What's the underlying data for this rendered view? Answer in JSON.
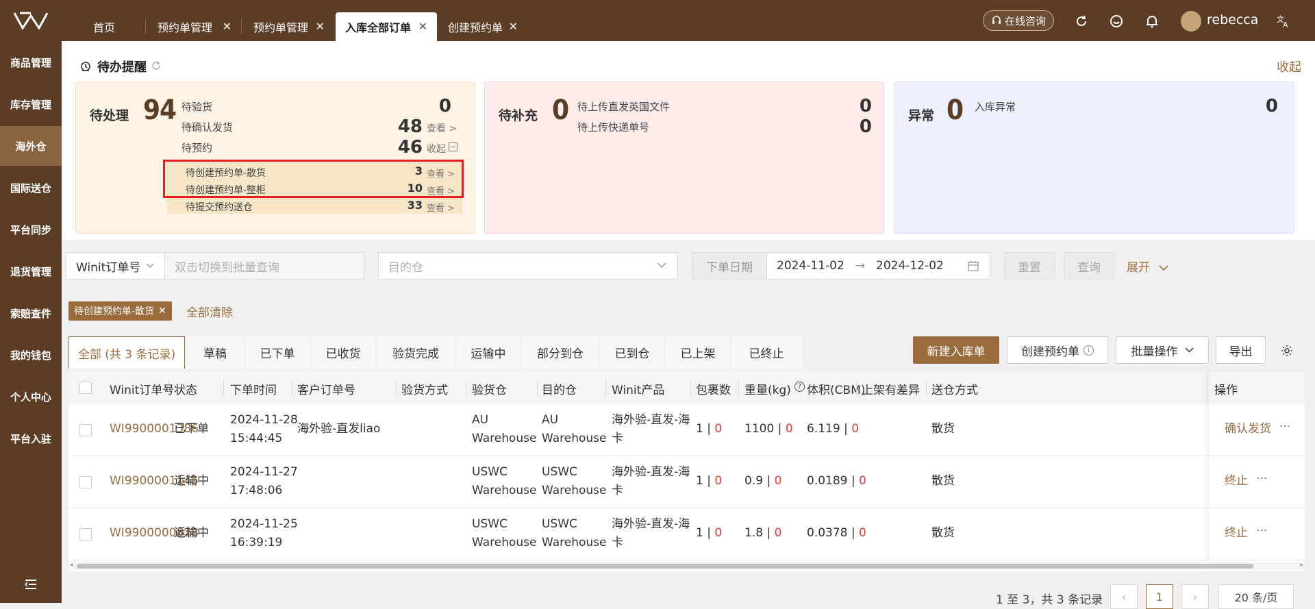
{
  "topbar": {
    "tabs": [
      {
        "label": "首页",
        "closable": false
      },
      {
        "label": "预约单管理",
        "closable": true
      },
      {
        "label": "预约单管理",
        "closable": true
      },
      {
        "label": "入库全部订单",
        "closable": true,
        "active": true
      },
      {
        "label": "创建预约单",
        "closable": true
      }
    ],
    "consult_label": "在线咨询",
    "username": "rebecca",
    "icons": [
      "refresh-icon",
      "smile-icon",
      "bell-icon",
      "translate-icon"
    ]
  },
  "sidebar": {
    "items": [
      "商品管理",
      "库存管理",
      "海外仓",
      "国际送仓",
      "平台同步",
      "退货管理",
      "索赔查件",
      "我的钱包",
      "个人中心",
      "平台入驻"
    ],
    "active_index": 2
  },
  "todo": {
    "title": "待办提醒",
    "collapse_label": "收起",
    "cards": [
      {
        "label": "待处理",
        "count": "94",
        "rows": [
          {
            "label": "待验货",
            "value": "0",
            "link": ""
          },
          {
            "label": "待确认发货",
            "value": "48",
            "link": "查看 >"
          },
          {
            "label": "待预约",
            "value": "46",
            "link": "收起"
          },
          {
            "label": "待创建预约单-散货",
            "value": "3",
            "link": "查看 >"
          },
          {
            "label": "待创建预约单-整柜",
            "value": "10",
            "link": "查看 >"
          },
          {
            "label": "待提交预约送仓",
            "value": "33",
            "link": "查看 >"
          }
        ]
      },
      {
        "label": "待补充",
        "count": "0",
        "rows": [
          {
            "label": "待上传直发英国文件",
            "value": "0"
          },
          {
            "label": "待上传快递单号",
            "value": "0"
          }
        ]
      },
      {
        "label": "异常",
        "count": "0",
        "rows": [
          {
            "label": "入库异常",
            "value": "0"
          }
        ]
      }
    ]
  },
  "filters": {
    "order_type": "Winit订单号",
    "batch_placeholder": "双击切换到批量查询",
    "warehouse_placeholder": "目的仓",
    "date_label": "下单日期",
    "date_start": "2024-11-02",
    "date_end": "2024-12-02",
    "reset_label": "重置",
    "query_label": "查询",
    "expand_label": "展开"
  },
  "chips": {
    "active_chip": "待创建预约单-散货",
    "clear_all": "全部清除"
  },
  "status_tabs": [
    "全部 (共 3 条记录)",
    "草稿",
    "已下单",
    "已收货",
    "验货完成",
    "运输中",
    "部分到仓",
    "已到仓",
    "已上架",
    "已终止"
  ],
  "actions": {
    "new_inbound": "新建入库单",
    "create_booking": "创建预约单",
    "batch_ops": "批量操作",
    "export": "导出"
  },
  "table": {
    "headers": [
      "Winit订单号",
      "状态",
      "下单时间",
      "客户订单号",
      "验货方式",
      "验货仓",
      "目的仓",
      "Winit产品",
      "包裹数",
      "重量(kg)",
      "体积(CBM)",
      "上架有差异",
      "送仓方式",
      "操作"
    ],
    "rows": [
      {
        "order": "WI9900001386",
        "status": "已下单",
        "date": "2024-11-28",
        "time": "15:44:45",
        "customer_order": "海外验-直发liao",
        "inspect_method": "",
        "inspect_wh": [
          "AU",
          "Warehouse"
        ],
        "dest_wh": [
          "AU",
          "Warehouse"
        ],
        "product": [
          "海外验-直发-海",
          "卡"
        ],
        "pkg": "1",
        "pkg_red": "0",
        "weight": "1100",
        "weight_red": "0",
        "volume": "6.119",
        "volume_red": "0",
        "diff": "",
        "delivery": "散货",
        "op": "确认发货"
      },
      {
        "order": "WI9900001145",
        "status": "运输中",
        "date": "2024-11-27",
        "time": "17:48:06",
        "customer_order": "",
        "inspect_method": "",
        "inspect_wh": [
          "USWC",
          "Warehouse"
        ],
        "dest_wh": [
          "USWC",
          "Warehouse"
        ],
        "product": [
          "海外验-直发-海",
          "卡"
        ],
        "pkg": "1",
        "pkg_red": "0",
        "weight": "0.9",
        "weight_red": "0",
        "volume": "0.0189",
        "volume_red": "0",
        "diff": "",
        "delivery": "散货",
        "op": "终止"
      },
      {
        "order": "WI9900000828",
        "status": "运输中",
        "date": "2024-11-25",
        "time": "16:39:19",
        "customer_order": "",
        "inspect_method": "",
        "inspect_wh": [
          "USWC",
          "Warehouse"
        ],
        "dest_wh": [
          "USWC",
          "Warehouse"
        ],
        "product": [
          "海外验-直发-海",
          "卡"
        ],
        "pkg": "1",
        "pkg_red": "0",
        "weight": "1.8",
        "weight_red": "0",
        "volume": "0.0378",
        "volume_red": "0",
        "diff": "",
        "delivery": "散货",
        "op": "终止"
      }
    ]
  },
  "pager": {
    "summary": "1 至 3，共 3 条记录",
    "current_page": "1",
    "page_size": "20 条/页"
  },
  "colors": {
    "brand": "#5a3d24",
    "accent": "#9a6b3d",
    "highlight": "#e02020"
  }
}
